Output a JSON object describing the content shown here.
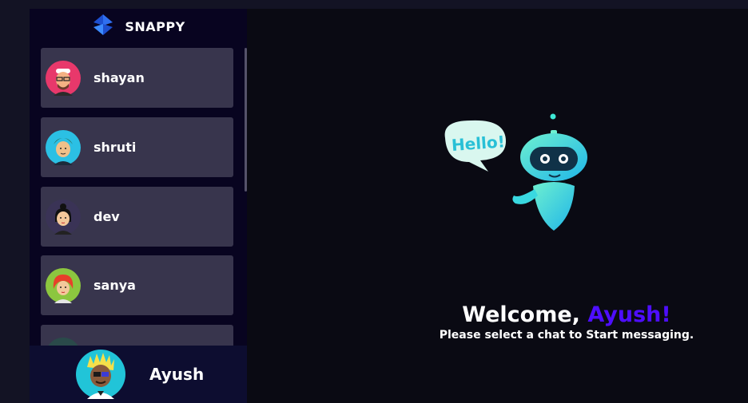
{
  "brand": {
    "name": "SNAPPY",
    "icon": "snappy-logo-icon"
  },
  "contacts": [
    {
      "name": "shayan",
      "avatar": "avatar-shayan",
      "color": "#e8386b"
    },
    {
      "name": "shruti",
      "avatar": "avatar-shruti",
      "color": "#2bc0e4"
    },
    {
      "name": "dev",
      "avatar": "avatar-dev",
      "color": "#3a3356"
    },
    {
      "name": "sanya",
      "avatar": "avatar-sanya",
      "color": "#8cc63f"
    },
    {
      "name": "",
      "avatar": "avatar-partial",
      "color": "#2a4a4a"
    }
  ],
  "current_user": {
    "name": "Ayush",
    "avatar": "avatar-ayush",
    "color": "#21c4d8"
  },
  "welcome": {
    "greeting": "Welcome,",
    "user_name": "Ayush!",
    "subtitle": "Please select a chat to Start messaging.",
    "bubble_text": "Hello!"
  },
  "colors": {
    "background": "#131324",
    "sidebar": "#080420",
    "contact_card": "#38354d",
    "accent": "#4e0eff"
  }
}
